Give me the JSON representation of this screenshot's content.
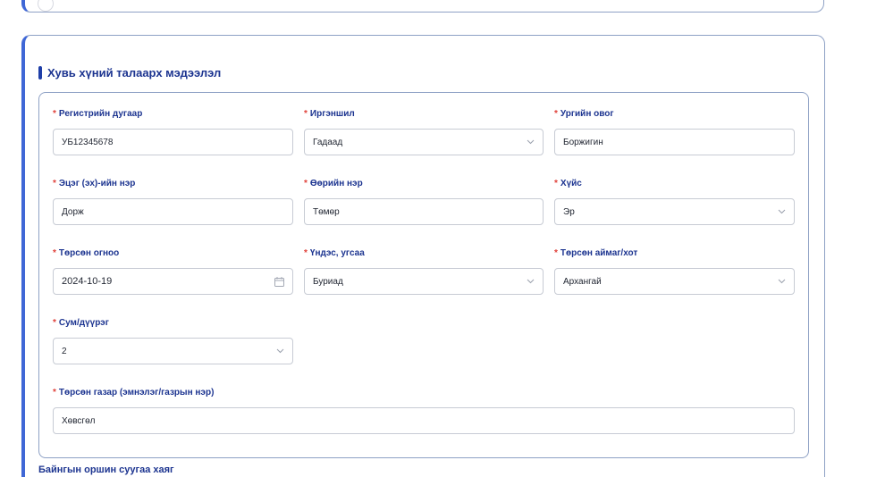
{
  "section_title": "Хувь хүний талаарх мэдээлэл",
  "fields": {
    "register": {
      "label": "Регистрийн дугаар",
      "value": "УБ12345678"
    },
    "citizenship": {
      "label": "Иргэншил",
      "value": "Гадаад"
    },
    "family_name": {
      "label": "Ургийн овог",
      "value": "Боржигин"
    },
    "father_name": {
      "label": "Эцэг (эх)-ийн нэр",
      "value": "Дорж"
    },
    "given_name": {
      "label": "Өөрийн нэр",
      "value": "Төмөр"
    },
    "gender": {
      "label": "Хүйс",
      "value": "Эр"
    },
    "birth_date": {
      "label": "Төрсөн огноо",
      "value": "2024-10-19"
    },
    "ethnicity": {
      "label": "Үндэс, угсаа",
      "value": "Буриад"
    },
    "birth_province": {
      "label": "Төрсөн аймаг/хот",
      "value": "Архангай"
    },
    "district": {
      "label": "Сум/дүүрэг",
      "value": "2"
    },
    "birth_place": {
      "label": "Төрсөн газар (эмнэлэг/газрын нэр)",
      "value": "Хөвсгөл"
    }
  },
  "required_marker": "*",
  "next_section_title": "Байнгын оршин суугаа хаяг",
  "icons": {
    "select": "chevron-down-icon",
    "date": "calendar-icon"
  },
  "colors": {
    "accent": "#3f67d6",
    "label": "#1c3490",
    "required": "#e0413a",
    "border": "#8ea1c5"
  }
}
